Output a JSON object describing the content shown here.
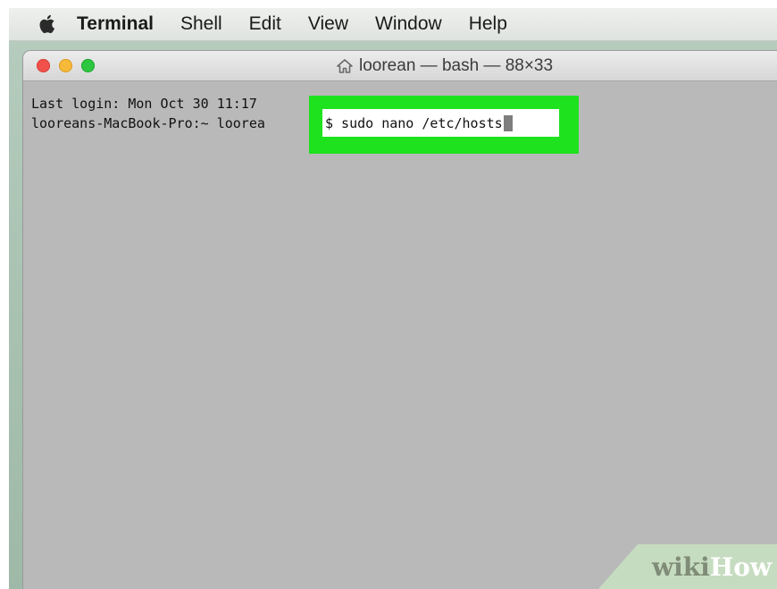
{
  "menubar": {
    "apple_icon": "apple-logo-icon",
    "app_name": "Terminal",
    "items": [
      {
        "label": "Shell"
      },
      {
        "label": "Edit"
      },
      {
        "label": "View"
      },
      {
        "label": "Window"
      },
      {
        "label": "Help"
      }
    ]
  },
  "window": {
    "title": "loorean — bash — 88×33",
    "title_icon": "home-icon",
    "traffic_lights": {
      "close": "#f0524b",
      "minimize": "#f6b93a",
      "zoom": "#2dc640"
    }
  },
  "terminal": {
    "line1": "Last login: Mon Oct 30 11:17",
    "line2_prefix": "looreans-MacBook-Pro:~ loorea",
    "command": "$ sudo nano /etc/hosts",
    "highlight_color": "#1ee21e"
  },
  "watermark": {
    "wiki": "wiki",
    "how": "How"
  }
}
